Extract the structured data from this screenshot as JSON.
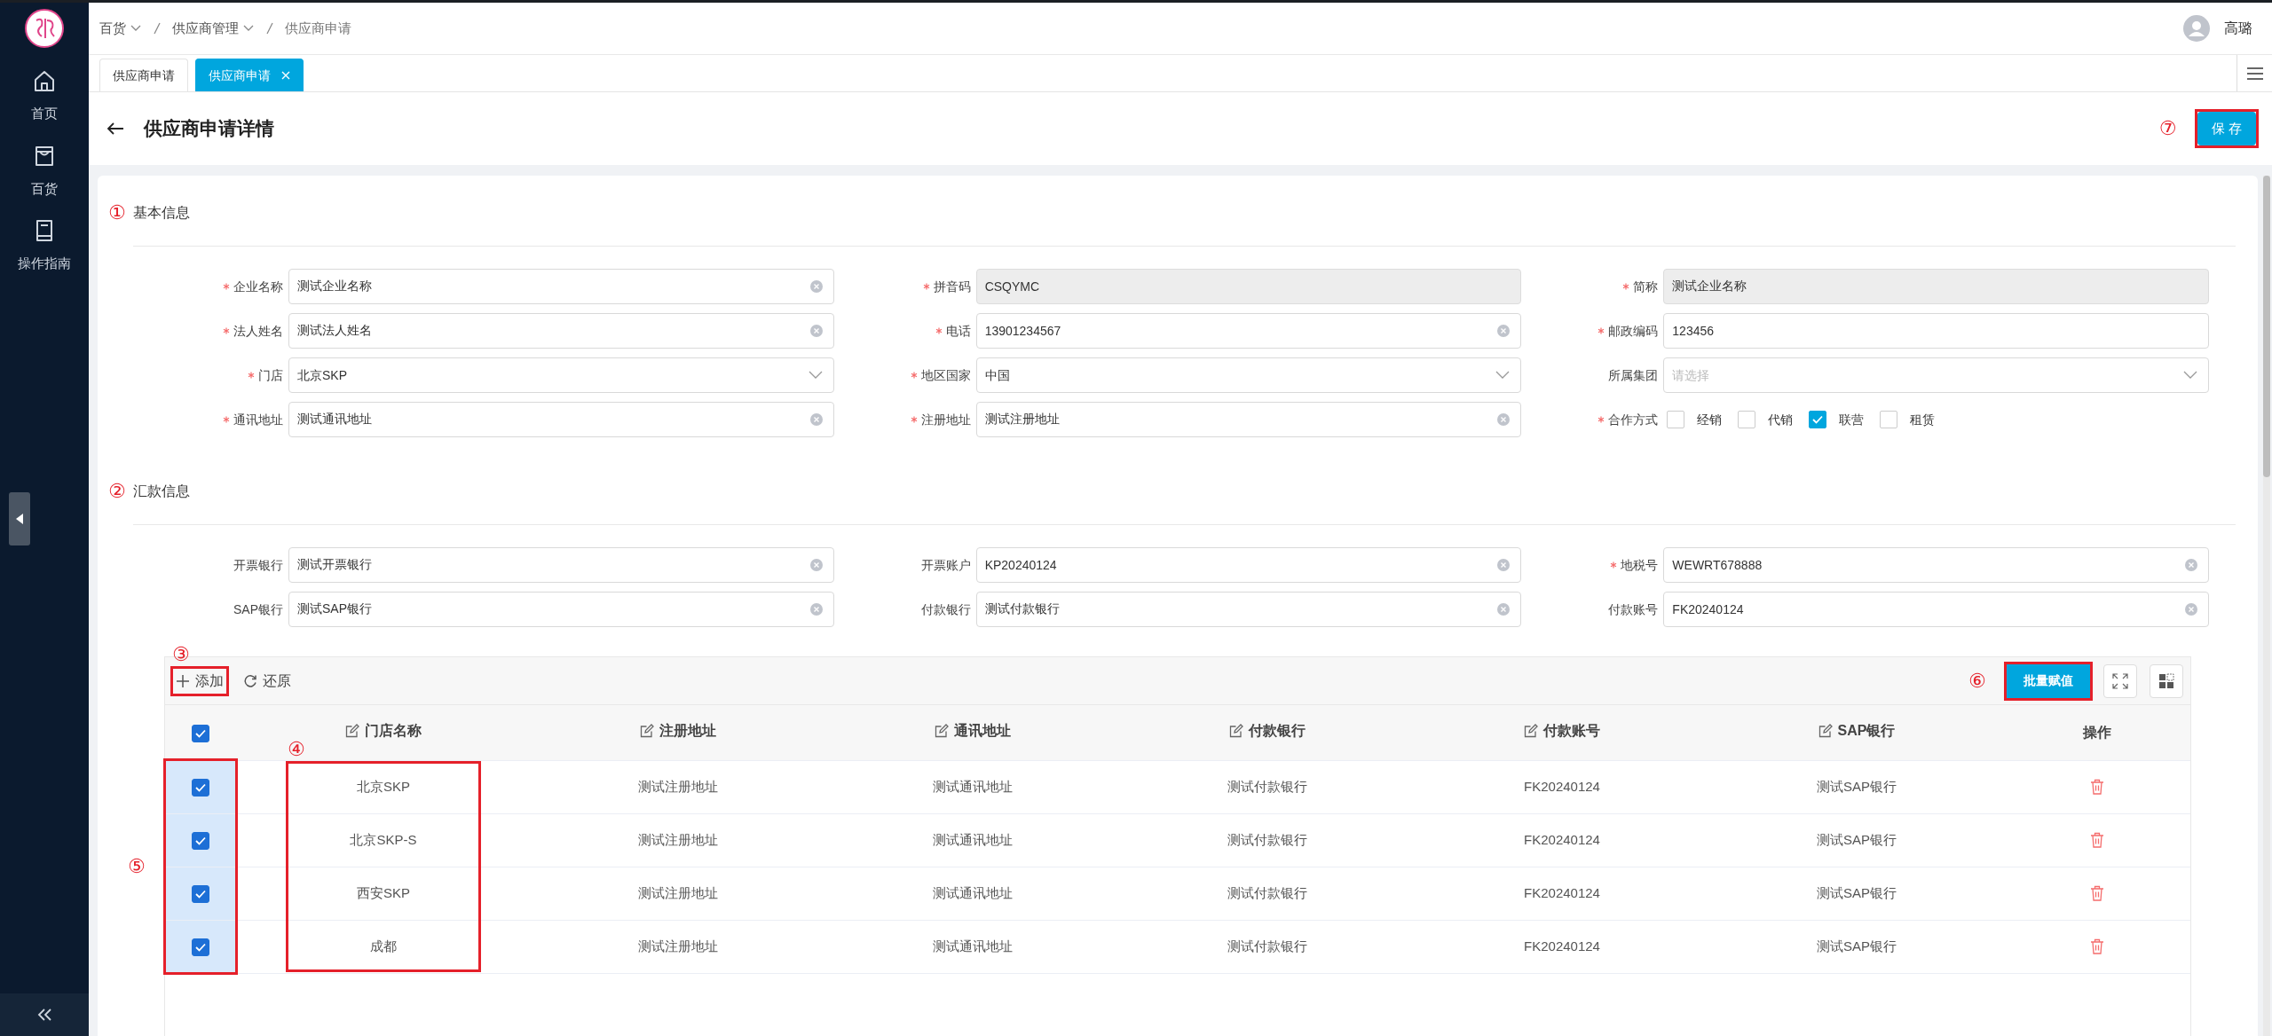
{
  "sidebar": {
    "items": [
      {
        "label": "首页",
        "kind": "home"
      },
      {
        "label": "百货",
        "kind": "bag"
      },
      {
        "label": "操作指南",
        "kind": "book"
      }
    ]
  },
  "breadcrumbs": [
    {
      "label": "百货",
      "dropdown": true
    },
    {
      "label": "供应商管理",
      "dropdown": true
    },
    {
      "label": "供应商申请",
      "dropdown": false
    }
  ],
  "user": {
    "name": "高璐"
  },
  "tabs": [
    {
      "label": "供应商申请",
      "selected": false
    },
    {
      "label": "供应商申请",
      "selected": true,
      "closable": true
    }
  ],
  "page": {
    "title": "供应商申请详情",
    "save_button": {
      "label": "保 存",
      "marker": "⑦",
      "highlighted": true
    }
  },
  "sections": [
    {
      "marker": "①",
      "title": "基本信息",
      "fields": [
        {
          "label": "企业名称",
          "required": true,
          "kind": "text",
          "value": "测试企业名称",
          "clearable": true
        },
        {
          "label": "拼音码",
          "required": true,
          "kind": "text",
          "value": "CSQYMC",
          "readonly": true
        },
        {
          "label": "简称",
          "required": true,
          "kind": "text",
          "value": "测试企业名称",
          "readonly": true
        },
        {
          "label": "法人姓名",
          "required": true,
          "kind": "text",
          "value": "测试法人姓名",
          "clearable": true
        },
        {
          "label": "电话",
          "required": true,
          "kind": "text",
          "value": "13901234567",
          "clearable": true
        },
        {
          "label": "邮政编码",
          "required": true,
          "kind": "text",
          "value": "123456"
        },
        {
          "label": "门店",
          "required": true,
          "kind": "select",
          "value": "北京SKP"
        },
        {
          "label": "地区国家",
          "required": true,
          "kind": "select",
          "value": "中国"
        },
        {
          "label": "所属集团",
          "kind": "select",
          "placeholder": "请选择"
        },
        {
          "label": "通讯地址",
          "required": true,
          "kind": "text",
          "value": "测试通讯地址",
          "clearable": true
        },
        {
          "label": "注册地址",
          "required": true,
          "kind": "text",
          "value": "测试注册地址",
          "clearable": true
        },
        {
          "label": "合作方式",
          "required": true,
          "kind": "checks",
          "options": [
            {
              "label": "经销",
              "checked": false
            },
            {
              "label": "代销",
              "checked": false
            },
            {
              "label": "联营",
              "checked": true
            },
            {
              "label": "租赁",
              "checked": false
            }
          ]
        }
      ]
    },
    {
      "marker": "②",
      "title": "汇款信息",
      "fields": [
        {
          "label": "开票银行",
          "kind": "text",
          "value": "测试开票银行",
          "clearable": true
        },
        {
          "label": "开票账户",
          "kind": "text",
          "value": "KP20240124",
          "clearable": true
        },
        {
          "label": "地税号",
          "required": true,
          "kind": "text",
          "value": "WEWRT678888",
          "clearable": true
        },
        {
          "label": "SAP银行",
          "kind": "text",
          "value": "测试SAP银行",
          "clearable": true
        },
        {
          "label": "付款银行",
          "kind": "text",
          "value": "测试付款银行",
          "clearable": true
        },
        {
          "label": "付款账号",
          "kind": "text",
          "value": "FK20240124",
          "clearable": true
        }
      ]
    }
  ],
  "table": {
    "add_button": {
      "label": "添加",
      "marker": "③",
      "highlighted": true
    },
    "reset_button": {
      "label": "还原"
    },
    "batch_button": {
      "label": "批量赋值",
      "marker": "⑥",
      "highlighted": true
    },
    "select_all": {
      "checked": true
    },
    "select_column": {
      "marker": "⑤",
      "highlighted": true
    },
    "columns": [
      {
        "label": "门店名称",
        "editable": true,
        "marker": "④",
        "highlighted": true
      },
      {
        "label": "注册地址",
        "editable": true
      },
      {
        "label": "通讯地址",
        "editable": true
      },
      {
        "label": "付款银行",
        "editable": true
      },
      {
        "label": "付款账号",
        "editable": true
      },
      {
        "label": "SAP银行",
        "editable": true
      },
      {
        "label": "操作",
        "editable": false
      }
    ],
    "rows": [
      {
        "selected": true,
        "cells": [
          "北京SKP",
          "测试注册地址",
          "测试通讯地址",
          "测试付款银行",
          "FK20240124",
          "测试SAP银行"
        ]
      },
      {
        "selected": true,
        "cells": [
          "北京SKP-S",
          "测试注册地址",
          "测试通讯地址",
          "测试付款银行",
          "FK20240124",
          "测试SAP银行"
        ]
      },
      {
        "selected": true,
        "cells": [
          "西安SKP",
          "测试注册地址",
          "测试通讯地址",
          "测试付款银行",
          "FK20240124",
          "测试SAP银行"
        ]
      },
      {
        "selected": true,
        "cells": [
          "成都",
          "测试注册地址",
          "测试通讯地址",
          "测试付款银行",
          "FK20240124",
          "测试SAP银行"
        ]
      }
    ]
  }
}
